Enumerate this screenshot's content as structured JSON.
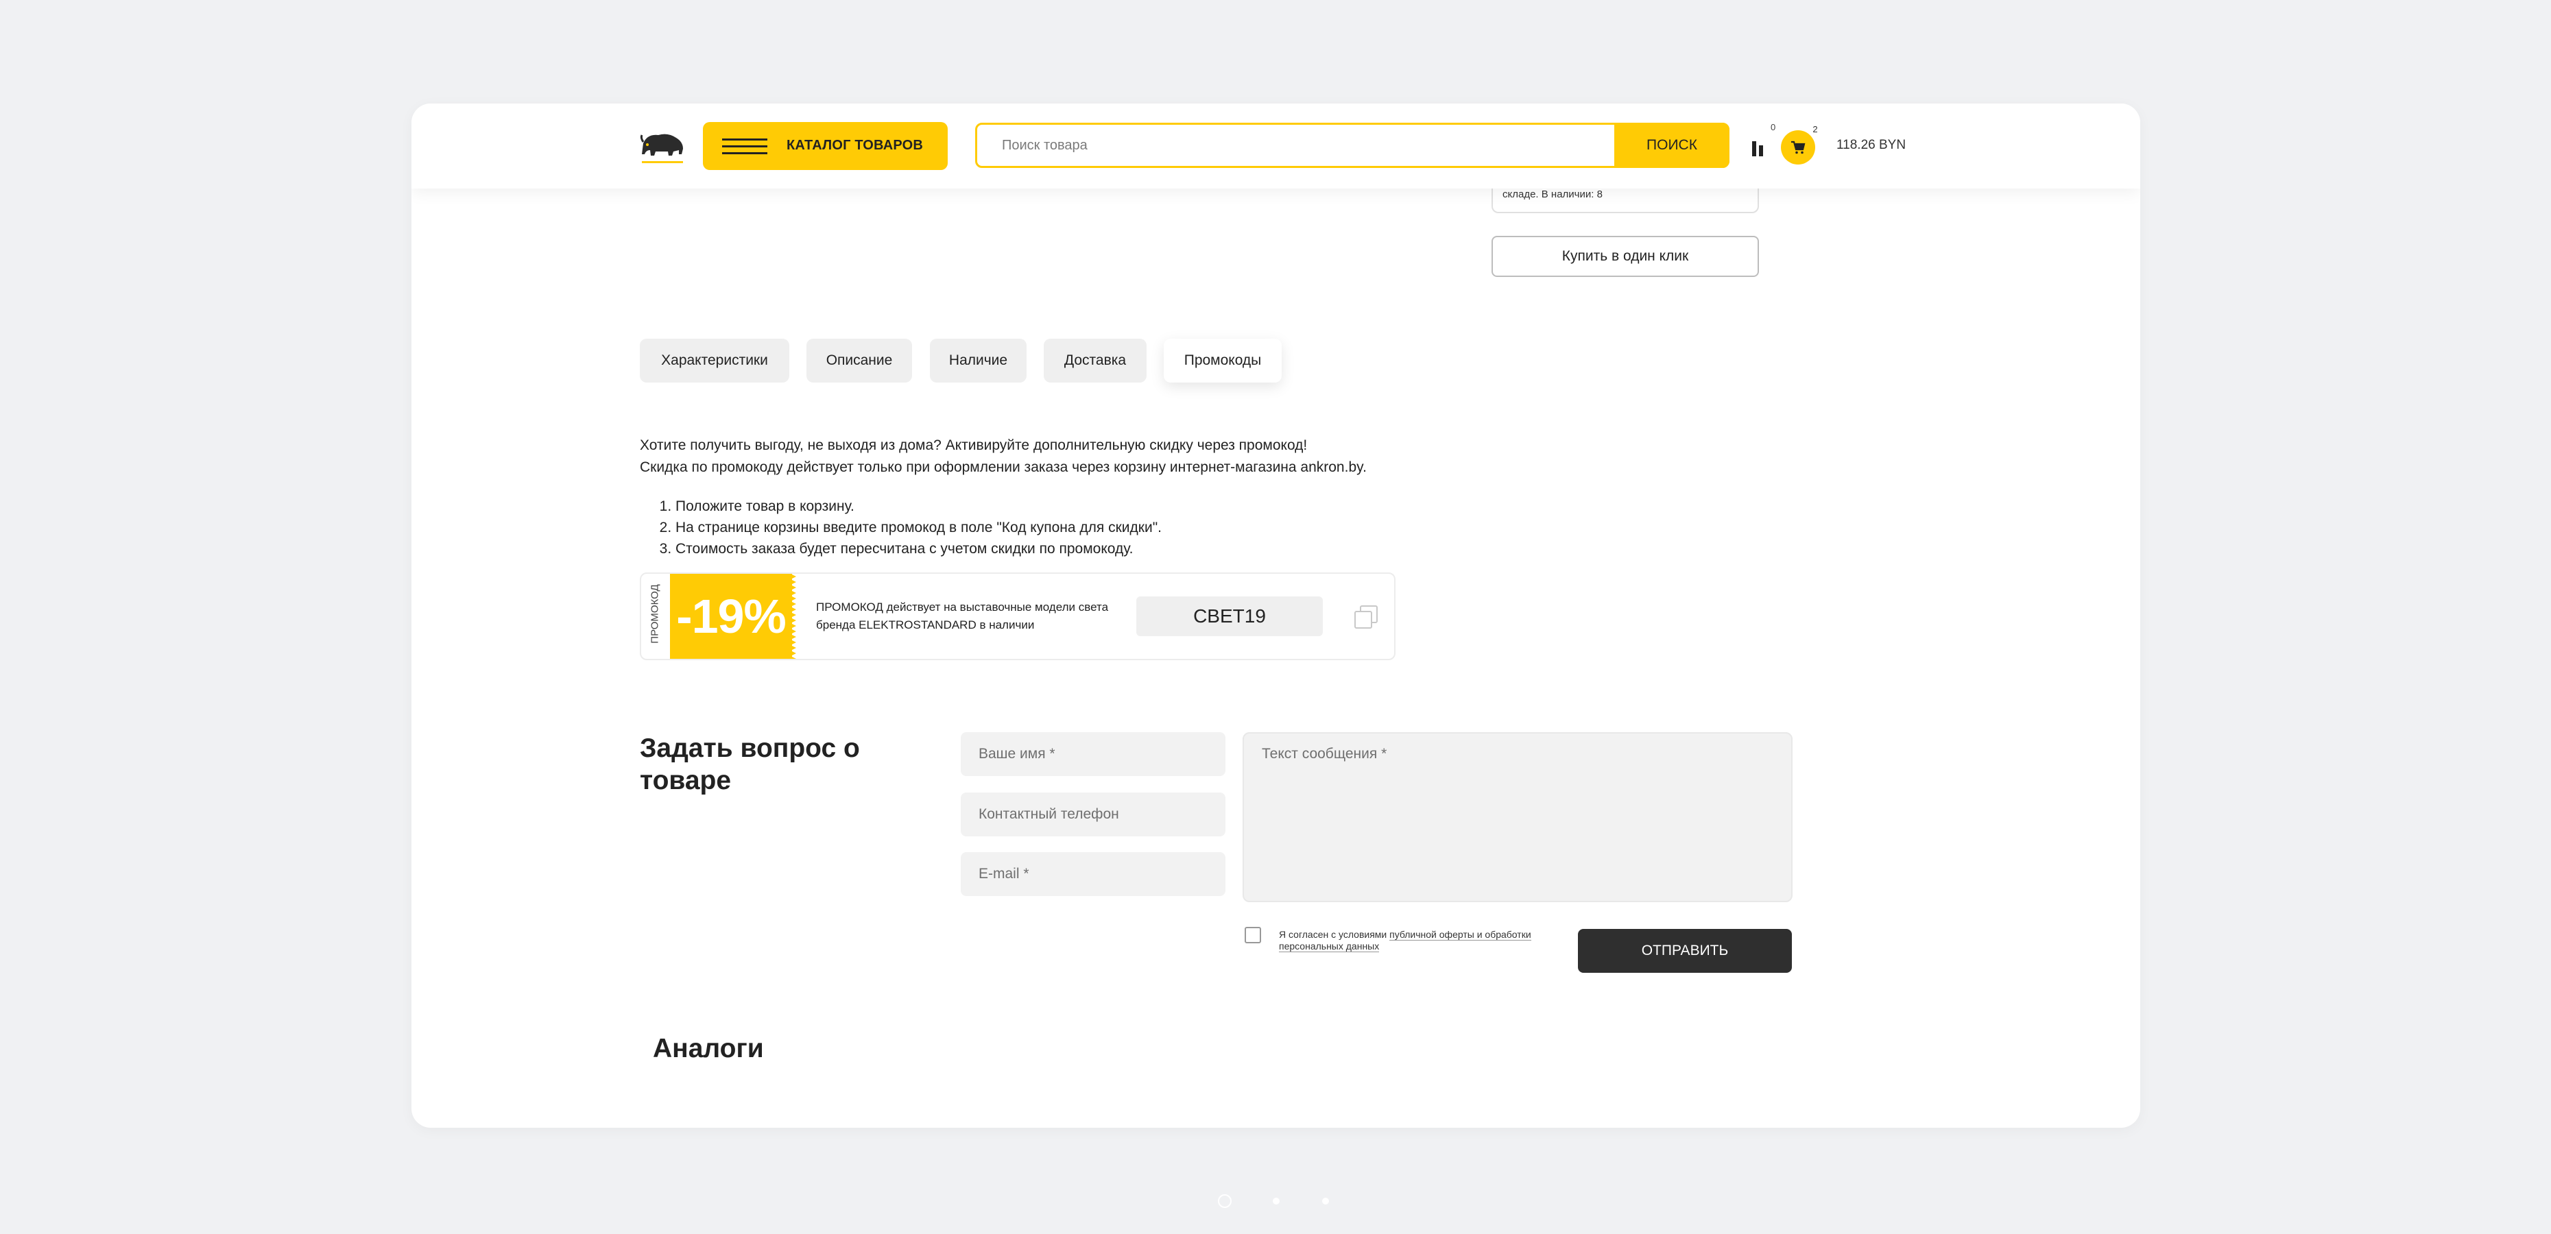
{
  "header": {
    "catalog_label": "КАТАЛОГ ТОВАРОВ",
    "search_placeholder": "Поиск товара",
    "search_button": "ПОИСК",
    "compare_count": "0",
    "cart_count": "2",
    "cart_total": "118.26 BYN"
  },
  "product": {
    "stock_text": "складе. В наличии: 8",
    "one_click_label": "Купить в один клик"
  },
  "tabs": [
    {
      "label": "Характеристики"
    },
    {
      "label": "Описание"
    },
    {
      "label": "Наличие"
    },
    {
      "label": "Доставка"
    },
    {
      "label": "Промокоды",
      "active": true
    }
  ],
  "promo": {
    "intro_line1": "Хотите получить выгоду, не выходя из дома? Активируйте дополнительную скидку через промокод!",
    "intro_line2": "Скидка по промокоду действует только при оформлении заказа через корзину интернет-магазина ankron.by.",
    "steps": [
      "Положите товар в корзину.",
      "На странице корзины введите промокод в поле \"Код купона для скидки\".",
      "Стоимость заказа будет пересчитана с учетом скидки по промокоду."
    ],
    "coupon": {
      "side_label": "ПРОМОКОД",
      "discount": "-19%",
      "description": "ПРОМОКОД действует на выставочные модели света бренда ELEKTROSTANDARD в наличии",
      "code": "СВЕТ19"
    }
  },
  "question_form": {
    "title": "Задать вопрос о товаре",
    "name_placeholder": "Ваше имя *",
    "phone_placeholder": "Контактный телефон",
    "email_placeholder": "E-mail *",
    "message_placeholder": "Текст сообщения *",
    "agree_prefix": "Я согласен с условиями ",
    "agree_link": "публичной оферты и обработки персональных данных",
    "submit_label": "ОТПРАВИТЬ"
  },
  "analogs_title": "Аналоги",
  "colors": {
    "accent": "#ffcb05",
    "dark_button": "#2f2f2f",
    "field_bg": "#f2f2f2",
    "page_bg": "#f0f1f3"
  }
}
